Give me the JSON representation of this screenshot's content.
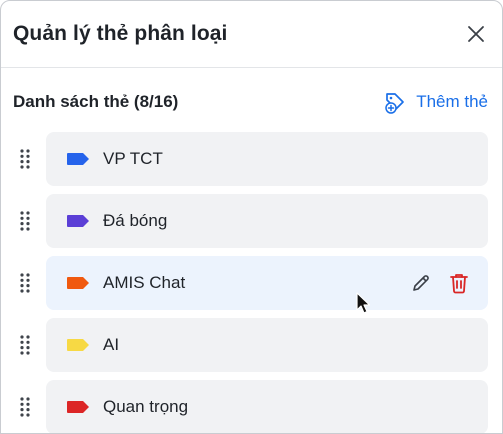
{
  "header": {
    "title": "Quản lý thẻ phân loại",
    "close_icon": "close-icon"
  },
  "list": {
    "title": "Danh sách thẻ (8/16)",
    "add_label": "Thêm thẻ",
    "add_icon": "tag-add-icon",
    "items": [
      {
        "label": "VP TCT",
        "color": "#2563eb"
      },
      {
        "label": "Đá bóng",
        "color": "#5b3fd6"
      },
      {
        "label": "AMIS Chat",
        "color": "#f0590f"
      },
      {
        "label": "AI",
        "color": "#f7d944"
      },
      {
        "label": "Quan trọng",
        "color": "#dc2626"
      }
    ]
  },
  "hovered_row_actions": {
    "edit_icon": "pencil-icon",
    "delete_icon": "trash-icon",
    "delete_color": "#d92626"
  }
}
